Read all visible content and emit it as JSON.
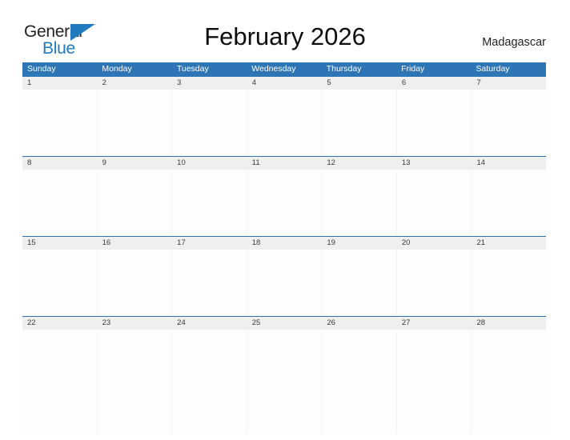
{
  "brand": {
    "name_part1": "General",
    "name_part2": "Blue",
    "flag_icon": "blue-triangle-flag-icon",
    "color_dark": "#231f20",
    "color_blue": "#1f7ac0"
  },
  "header": {
    "title": "February 2026",
    "country": "Madagascar"
  },
  "colors": {
    "header_blue": "#2e75b6",
    "date_band_gray": "#efefef",
    "date_text": "#3a3a3a",
    "cell_background": "#fdfdfd"
  },
  "calendar": {
    "weekdays": [
      "Sunday",
      "Monday",
      "Tuesday",
      "Wednesday",
      "Thursday",
      "Friday",
      "Saturday"
    ],
    "weeks": [
      {
        "days": [
          "1",
          "2",
          "3",
          "4",
          "5",
          "6",
          "7"
        ]
      },
      {
        "days": [
          "8",
          "9",
          "10",
          "11",
          "12",
          "13",
          "14"
        ]
      },
      {
        "days": [
          "15",
          "16",
          "17",
          "18",
          "19",
          "20",
          "21"
        ]
      },
      {
        "days": [
          "22",
          "23",
          "24",
          "25",
          "26",
          "27",
          "28"
        ]
      }
    ]
  }
}
